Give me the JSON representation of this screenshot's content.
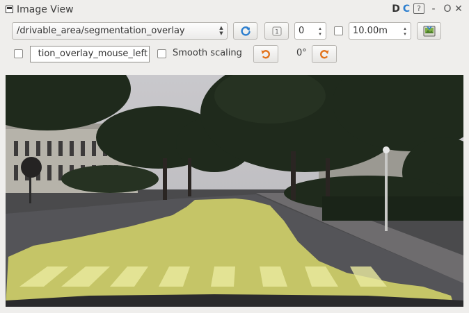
{
  "window": {
    "title": "Image View",
    "title_buttons": [
      "D",
      "C",
      "?",
      "-",
      "O",
      "✕"
    ]
  },
  "toolbar": {
    "topic": "/drivable_area/segmentation_overlay",
    "refresh_icon": "refresh-icon",
    "rotation_value": "0",
    "max_range": "10.00m",
    "save_icon": "save-image-icon",
    "mouse_topic": "tion_overlay_mouse_left",
    "smooth_scaling_label": "Smooth scaling",
    "smooth_scaling_checked": false,
    "rotate_ccw_icon": "rotate-left-icon",
    "rotation_label": "0°",
    "rotate_cw_icon": "rotate-right-icon"
  },
  "colors": {
    "overlay": "#dede6a",
    "accent_orange": "#e2731c",
    "accent_blue": "#2d7fcf"
  }
}
